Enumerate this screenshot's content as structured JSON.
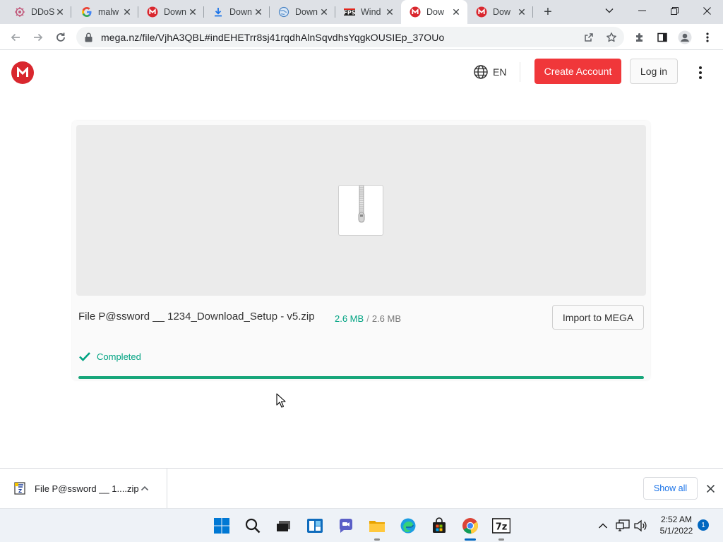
{
  "browser": {
    "tabs": [
      {
        "title": "DDoS",
        "icon": "bio-site-icon",
        "active": false
      },
      {
        "title": "malw",
        "icon": "google-icon",
        "active": false
      },
      {
        "title": "Down",
        "icon": "mega-icon",
        "active": false
      },
      {
        "title": "Down",
        "icon": "download-arrow-icon",
        "active": false
      },
      {
        "title": "Down",
        "icon": "globe-site-icon",
        "active": false
      },
      {
        "title": "Wind",
        "icon": "fps-site-icon",
        "active": false
      },
      {
        "title": "Dow",
        "icon": "mega-icon",
        "active": true
      },
      {
        "title": "Dow",
        "icon": "mega-icon",
        "active": false
      }
    ],
    "url": "mega.nz/file/VjhA3QBL#indEHETrr8sj41rqdhAlnSqvdhsYqgkOUSIEp_37OUo"
  },
  "header": {
    "language": "EN",
    "create_account": "Create Account",
    "login": "Log in"
  },
  "file": {
    "name": "File P@ssword __ 1234_Download_Setup - v5.zip",
    "downloaded": "2.6 MB",
    "slash": "/",
    "total": "2.6 MB",
    "import_button": "Import to MEGA",
    "status": "Completed",
    "progress": 1.0
  },
  "download_shelf": {
    "item_name": "File P@ssword __ 1....zip",
    "show_all": "Show all"
  },
  "taskbar": {
    "time": "2:52 AM",
    "date": "5/1/2022",
    "notifications": "1"
  },
  "colors": {
    "mega_red": "#d9272e",
    "create_btn": "#f0373a",
    "success_green": "#00a382",
    "progress_green": "#17a67a",
    "link_blue": "#1a73e8"
  }
}
